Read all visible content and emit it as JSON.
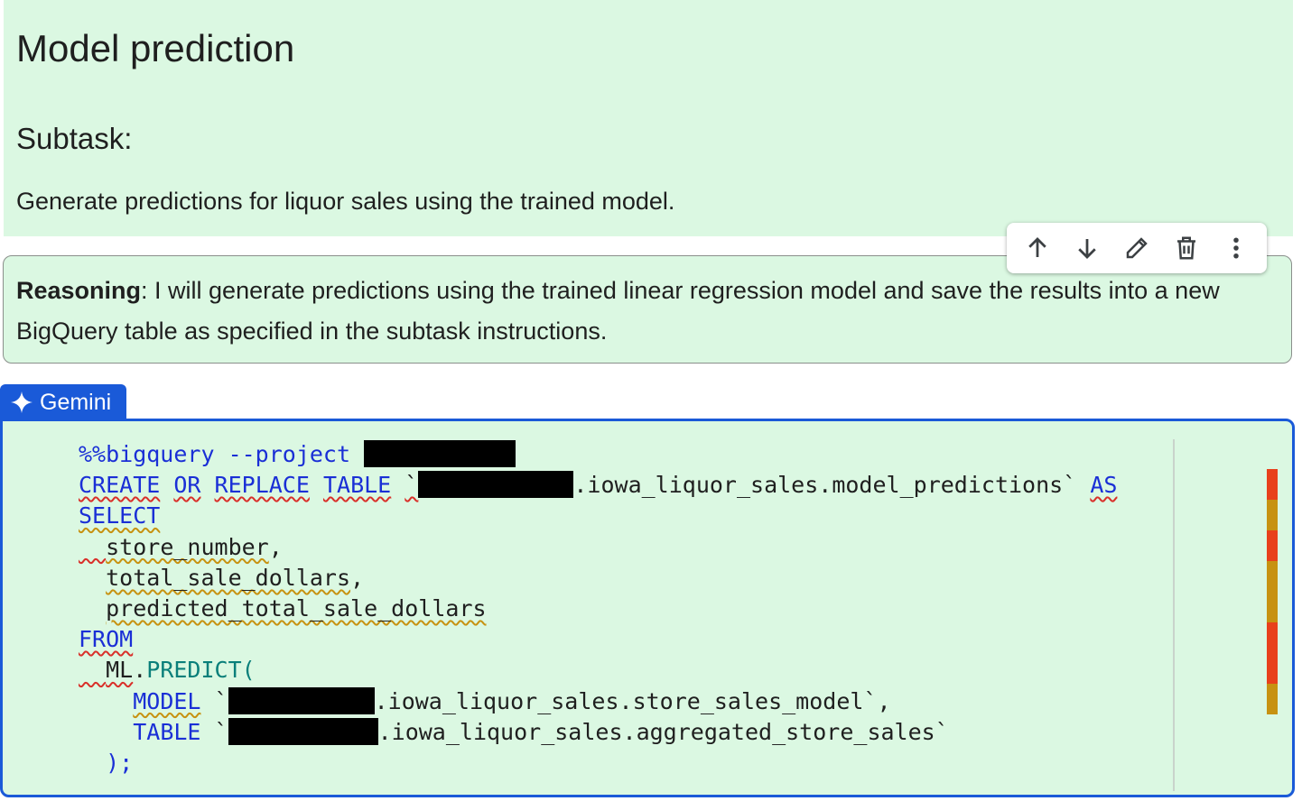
{
  "text_cell": {
    "heading": "Model prediction",
    "subheading": "Subtask:",
    "paragraph": "Generate predictions for liquor sales using the trained model."
  },
  "reasoning_cell": {
    "label": "Reasoning",
    "text": ": I will generate predictions using the trained linear regression model and save the results into a new BigQuery table as specified in the subtask instructions."
  },
  "toolbar": {
    "icons": [
      "arrow-up-icon",
      "arrow-down-icon",
      "edit-icon",
      "delete-icon",
      "more-vert-icon"
    ]
  },
  "gemini_tab": {
    "label": "Gemini",
    "color": "#1a5ad8"
  },
  "code_cell": {
    "l1_magic": "%%bigquery --project",
    "l2_create": "CREATE",
    "l2_or": "OR",
    "l2_replace": "REPLACE",
    "l2_table": "TABLE",
    "l2_tick": "`",
    "l2_rest": ".iowa_liquor_sales.model_predictions`",
    "l2_as": "AS",
    "l3_select": "SELECT",
    "l4_col": "store_number",
    "l5_col": "total_sale_dollars",
    "l6_col": "predicted_total_sale_dollars",
    "l7_from": "FROM",
    "l8_ml": "ML",
    "l8_predict": "PREDICT(",
    "l9_model": "MODEL",
    "l9_rest": ".iowa_liquor_sales.store_sales_model`,",
    "l10_table": "TABLE",
    "l10_rest": ".iowa_liquor_sales.aggregated_store_sales`",
    "l11_close": ");"
  },
  "colors": {
    "cell_bg": "#dbf8e2",
    "keyword": "#1a2fd6",
    "function": "#0a7f7a",
    "error_marker": "#e8401b",
    "warning_marker": "#c79211"
  }
}
